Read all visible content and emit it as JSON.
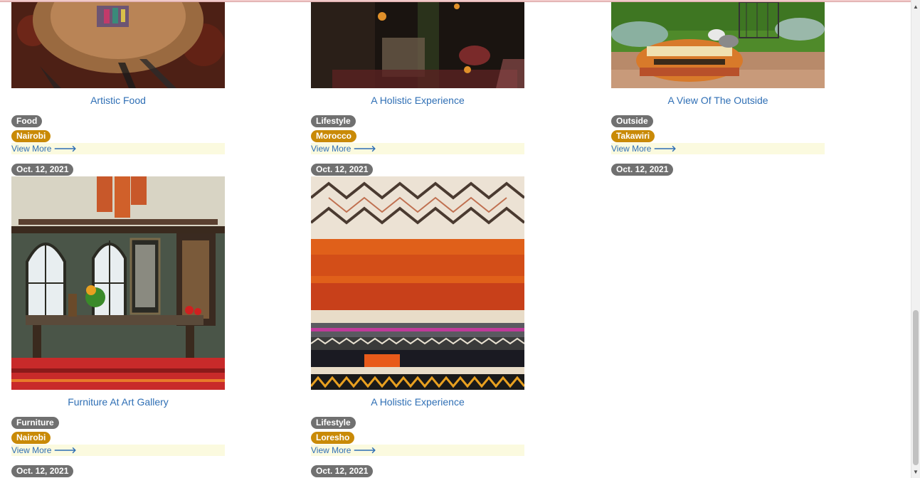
{
  "view_more_label": "View More",
  "cards": [
    {
      "title": "Artistic Food",
      "category": "Food",
      "location": "Nairobi",
      "date": "Oct. 12, 2021"
    },
    {
      "title": "A Holistic Experience",
      "category": "Lifestyle",
      "location": "Morocco",
      "date": "Oct. 12, 2021"
    },
    {
      "title": "A View Of The Outside",
      "category": "Outside",
      "location": "Takawiri",
      "date": "Oct. 12, 2021"
    },
    {
      "title": "Furniture At Art Gallery",
      "category": "Furniture",
      "location": "Nairobi",
      "date": "Oct. 12, 2021"
    },
    {
      "title": "A Holistic Experience",
      "category": "Lifestyle",
      "location": "Loresho",
      "date": "Oct. 12, 2021"
    }
  ],
  "colors": {
    "link": "#2f6fb5",
    "category_badge": "#707070",
    "location_badge": "#c98a07",
    "view_more_bg": "#fbfadf"
  }
}
